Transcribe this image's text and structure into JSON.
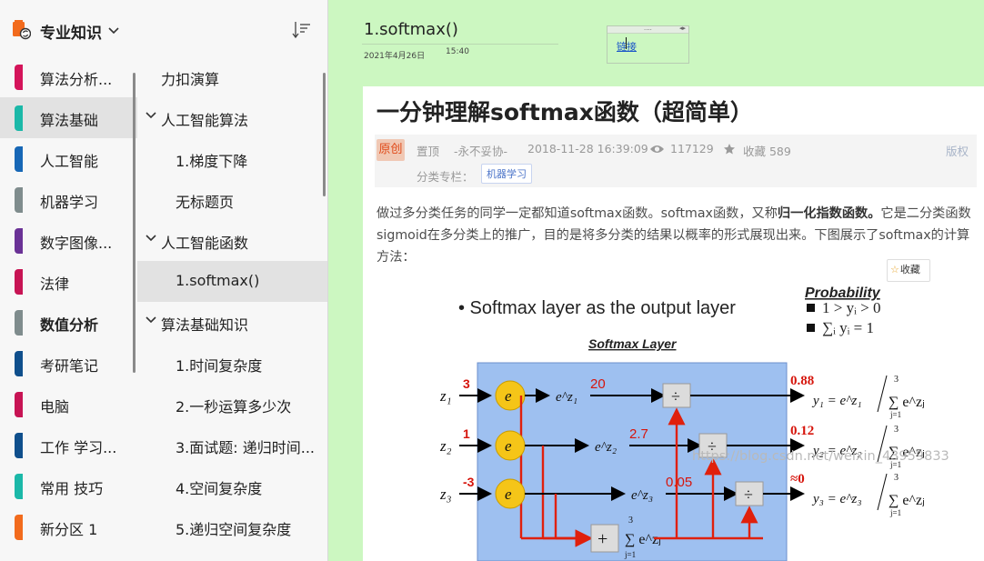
{
  "notebook": {
    "title": "专业知识"
  },
  "sections": [
    {
      "label": "算法分析...",
      "color": "#d4145a",
      "selected": false,
      "bold": false
    },
    {
      "label": "算法基础",
      "color": "#1bb8a8",
      "selected": true,
      "bold": false
    },
    {
      "label": "人工智能",
      "color": "#1767b6",
      "selected": false,
      "bold": false
    },
    {
      "label": "机器学习",
      "color": "#7f8c8d",
      "selected": false,
      "bold": false
    },
    {
      "label": "数字图像...",
      "color": "#6a3296",
      "selected": false,
      "bold": false
    },
    {
      "label": "法律",
      "color": "#c71454",
      "selected": false,
      "bold": false
    },
    {
      "label": "数值分析",
      "color": "#7f8c8d",
      "selected": false,
      "bold": true
    },
    {
      "label": "考研笔记",
      "color": "#0f4f8c",
      "selected": false,
      "bold": false
    },
    {
      "label": "电脑",
      "color": "#c71454",
      "selected": false,
      "bold": false
    },
    {
      "label": "工作 学习...",
      "color": "#0f4f8c",
      "selected": false,
      "bold": false
    },
    {
      "label": "常用 技巧",
      "color": "#1bb8a8",
      "selected": false,
      "bold": false
    },
    {
      "label": "新分区 1",
      "color": "#f26b1d",
      "selected": false,
      "bold": false
    }
  ],
  "pages": [
    {
      "label": "力扣演算",
      "level": 0,
      "expandable": false,
      "selected": false
    },
    {
      "label": "人工智能算法",
      "level": 0,
      "expandable": true,
      "selected": false
    },
    {
      "label": "1.梯度下降",
      "level": 1,
      "expandable": false,
      "selected": false
    },
    {
      "label": "无标题页",
      "level": 1,
      "expandable": false,
      "selected": false
    },
    {
      "label": "人工智能函数",
      "level": 0,
      "expandable": true,
      "selected": false
    },
    {
      "label": "1.softmax()",
      "level": 1,
      "expandable": false,
      "selected": true
    },
    {
      "label": "算法基础知识",
      "level": 0,
      "expandable": true,
      "selected": false
    },
    {
      "label": "1.时间复杂度",
      "level": 1,
      "expandable": false,
      "selected": false
    },
    {
      "label": "2.一秒运算多少次",
      "level": 1,
      "expandable": false,
      "selected": false
    },
    {
      "label": "3.面试题: 递归时间...",
      "level": 1,
      "expandable": false,
      "selected": false
    },
    {
      "label": "4.空间复杂度",
      "level": 1,
      "expandable": false,
      "selected": false
    },
    {
      "label": "5.递归空间复杂度",
      "level": 1,
      "expandable": false,
      "selected": false
    }
  ],
  "page": {
    "title": "1.softmax()",
    "date": "2021年4月26日",
    "time": "15:40"
  },
  "link_box": {
    "dots": "....",
    "arrows": "◂▸",
    "text": "链接"
  },
  "article": {
    "title": "一分钟理解softmax函数（超简单）",
    "badge": "原创",
    "pin": "置顶",
    "author": "-永不妥协-",
    "datetime": "2018-11-28 16:39:09",
    "views": "117129",
    "favorites_label": "收藏 589",
    "copyright": "版权",
    "category_label": "分类专栏：",
    "category_tag": "机器学习",
    "para_1": "做过多分类任务的同学一定都知道softmax函数。softmax函数，又称",
    "para_bold": "归一化指数函数。",
    "para_2": "它是二分类函数sigmoid在多分类上的推广，目的是将多分类的结果以概率的形式展现出来。下图展示了softmax的计算方法：",
    "collect_button": "收藏"
  },
  "figure": {
    "bullet": "• Softmax layer as the output layer",
    "prob_title": "Probability",
    "prob_1": "1 > yᵢ > 0",
    "prob_2": "∑ᵢ yᵢ = 1",
    "layer_title": "Softmax Layer",
    "z_labels": [
      "z₁",
      "z₂",
      "z₃"
    ],
    "z_values": [
      "3",
      "1",
      "-3"
    ],
    "exp_values": [
      "20",
      "2.7",
      "0.05"
    ],
    "exp_labels": [
      "e^z₁",
      "e^z₂",
      "e^z₃"
    ],
    "node_label": "e",
    "divide_symbol": "÷",
    "plus_symbol": "+",
    "sum_expr": "∑ e^zⱼ",
    "outputs": [
      "0.88",
      "0.12",
      "≈0"
    ],
    "y_labels": [
      "y₁ = e^z₁",
      "y₂ = e^z₂",
      "y₃ = e^z₃"
    ],
    "sum_upper": "3",
    "sum_lower": "j=1",
    "colors": {
      "layer_bg": "#9ec0f0",
      "arrow_red": "#e0200c",
      "node": "#f5c518",
      "value_red": "#d6150c"
    }
  },
  "watermark": "https://blog.csdn.net/weixin_43959833"
}
